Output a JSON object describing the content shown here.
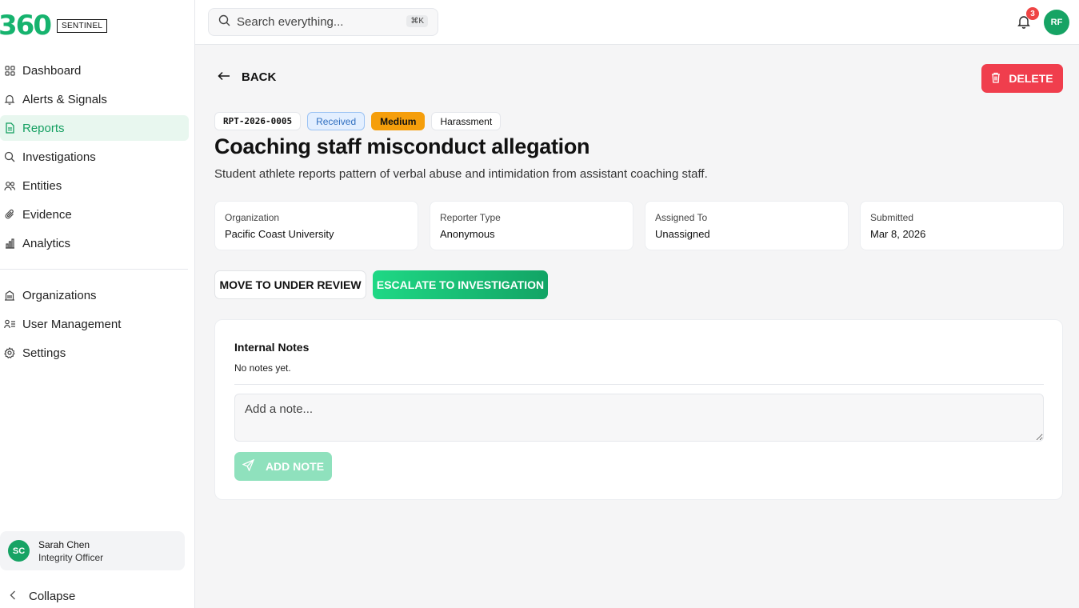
{
  "brand": {
    "logo": "360",
    "badge": "SENTINEL"
  },
  "sidebar": {
    "primary": [
      {
        "label": "Dashboard",
        "icon": "grid-icon"
      },
      {
        "label": "Alerts & Signals",
        "icon": "bell-icon"
      },
      {
        "label": "Reports",
        "icon": "file-icon",
        "active": true
      },
      {
        "label": "Investigations",
        "icon": "search-icon"
      },
      {
        "label": "Entities",
        "icon": "users-icon"
      },
      {
        "label": "Evidence",
        "icon": "paperclip-icon"
      },
      {
        "label": "Analytics",
        "icon": "bar-chart-icon"
      }
    ],
    "secondary": [
      {
        "label": "Organizations",
        "icon": "building-icon"
      },
      {
        "label": "User Management",
        "icon": "user-list-icon"
      },
      {
        "label": "Settings",
        "icon": "gear-icon"
      }
    ],
    "user": {
      "initials": "SC",
      "name": "Sarah Chen",
      "role": "Integrity Officer"
    },
    "collapse_label": "Collapse"
  },
  "topbar": {
    "search_placeholder": "Search everything...",
    "shortcut": "⌘K",
    "notification_count": "3",
    "avatar_initials": "RF"
  },
  "report": {
    "back_label": "BACK",
    "delete_label": "DELETE",
    "id": "RPT-2026-0005",
    "status": "Received",
    "severity": "Medium",
    "category": "Harassment",
    "title": "Coaching staff misconduct allegation",
    "description": "Student athlete reports pattern of verbal abuse and intimidation from assistant coaching staff.",
    "details": [
      {
        "label": "Organization",
        "value": "Pacific Coast University"
      },
      {
        "label": "Reporter Type",
        "value": "Anonymous"
      },
      {
        "label": "Assigned To",
        "value": "Unassigned"
      },
      {
        "label": "Submitted",
        "value": "Mar 8, 2026"
      }
    ],
    "actions": {
      "review_label": "MOVE TO UNDER REVIEW",
      "escalate_label": "ESCALATE TO INVESTIGATION"
    }
  },
  "notes": {
    "title": "Internal Notes",
    "empty_text": "No notes yet.",
    "input_placeholder": "Add a note...",
    "add_label": "ADD NOTE"
  },
  "colors": {
    "brand_green": "#16b36e",
    "delete_red": "#f03e4d",
    "severity_orange": "#f59e0b",
    "status_blue": "#2f6fc0"
  }
}
